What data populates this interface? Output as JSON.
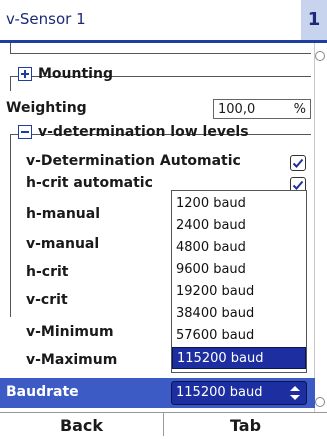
{
  "header": {
    "title": "v-Sensor 1",
    "page_badge": "1"
  },
  "groups": {
    "mounting": {
      "label": "Mounting"
    },
    "weighting": {
      "label": "Weighting",
      "value": "100,0",
      "unit": "%"
    },
    "low_levels": {
      "label": "v-determination low levels"
    }
  },
  "rows": {
    "v_det_auto": "v-Determination Automatic",
    "h_crit_auto": "h-crit automatic",
    "h_manual": "h-manual",
    "v_manual": "v-manual",
    "h_crit": "h-crit",
    "v_crit": "v-crit",
    "v_min": "v-Minimum",
    "v_max": "v-Maximum"
  },
  "checks": {
    "v_det_auto": true,
    "h_crit_auto": true
  },
  "baudrate": {
    "label": "Baudrate",
    "selected": "115200 baud",
    "options": [
      "1200 baud",
      "2400 baud",
      "4800 baud",
      "9600 baud",
      "19200 baud",
      "38400 baud",
      "57600 baud",
      "115200 baud"
    ]
  },
  "footer": {
    "back": "Back",
    "tab": "Tab"
  },
  "colors": {
    "accent": "#1d2fa0",
    "highlight_row": "#3d5bc4",
    "header_text": "#1d2a7a"
  }
}
